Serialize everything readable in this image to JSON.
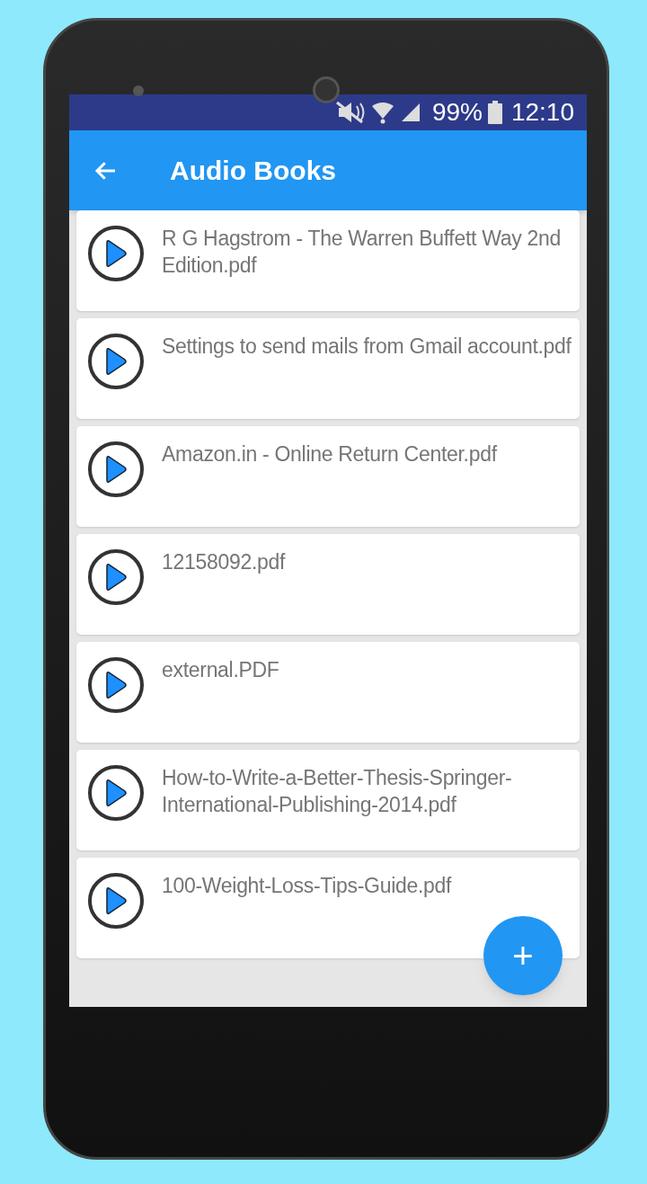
{
  "status_bar": {
    "battery": "99%",
    "time": "12:10"
  },
  "app_bar": {
    "title": "Audio Books"
  },
  "files": [
    {
      "name": "R G Hagstrom - The Warren Buffett Way 2nd Edition.pdf"
    },
    {
      "name": "Settings to send mails from Gmail account.pdf"
    },
    {
      "name": "Amazon.in - Online Return Center.pdf"
    },
    {
      "name": "12158092.pdf"
    },
    {
      "name": "external.PDF"
    },
    {
      "name": "How-to-Write-a-Better-Thesis-Springer-International-Publishing-2014.pdf"
    },
    {
      "name": "100-Weight-Loss-Tips-Guide.pdf"
    }
  ],
  "fab": {
    "label": "+"
  }
}
